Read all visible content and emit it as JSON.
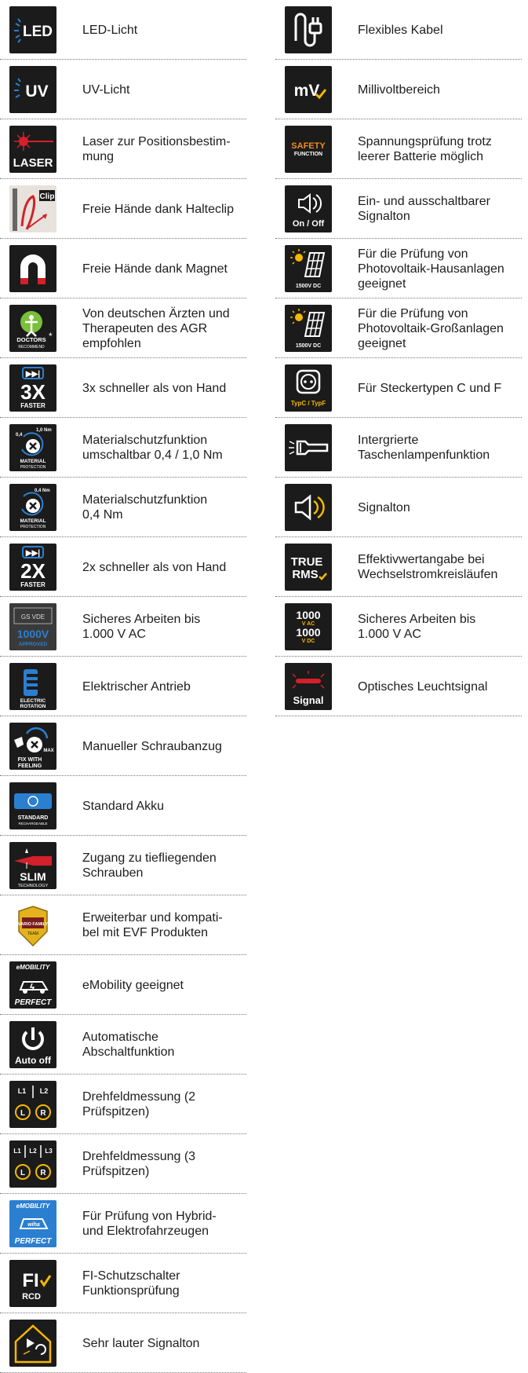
{
  "left_column": [
    {
      "icon": "led-icon",
      "icon_text": "LED",
      "label": "LED-Licht"
    },
    {
      "icon": "uv-icon",
      "icon_text": "UV",
      "label": "UV-Licht"
    },
    {
      "icon": "laser-icon",
      "icon_text": "LASER",
      "label": "Laser zur Positionsbestim-\nmung"
    },
    {
      "icon": "clip-icon",
      "icon_text": "Clip",
      "label": "Freie Hände dank Halteclip"
    },
    {
      "icon": "magnet-icon",
      "icon_text": "",
      "label": "Freie Hände dank Magnet"
    },
    {
      "icon": "doctors-recommend-icon",
      "icon_text": "DOCTORS RECOMMEND",
      "label": "Von deutschen Ärzten und\nTherapeuten des AGR\nempfohlen"
    },
    {
      "icon": "3x-faster-icon",
      "icon_text": "3X FASTER",
      "label": "3x schneller als von Hand"
    },
    {
      "icon": "material-protection-dual-icon",
      "icon_text": "0,4 1,0 Nm MATERIAL PROTECTION",
      "label": "Materialschutzfunktion\numschaltbar 0,4 / 1,0 Nm"
    },
    {
      "icon": "material-protection-icon",
      "icon_text": "0,4 Nm MATERIAL PROTECTION",
      "label": "Materialschutzfunktion\n0,4 Nm"
    },
    {
      "icon": "2x-faster-icon",
      "icon_text": "2X FASTER",
      "label": "2x schneller als von Hand"
    },
    {
      "icon": "1000v-approved-icon",
      "icon_text": "1000V APPROVED",
      "label": "Sicheres Arbeiten bis\n1.000 V AC"
    },
    {
      "icon": "electric-rotation-icon",
      "icon_text": "ELECTRIC ROTATION",
      "label": "Elektrischer Antrieb"
    },
    {
      "icon": "fix-with-feeling-icon",
      "icon_text": "FIX WITH FEELING",
      "label": "Manueller Schraubanzug"
    },
    {
      "icon": "standard-battery-icon",
      "icon_text": "STANDARD RECHARGEABLE",
      "label": "Standard Akku"
    },
    {
      "icon": "slim-technology-icon",
      "icon_text": "SLIM TECHNOLOGY",
      "label": "Zugang zu tiefliegenden\nSchrauben"
    },
    {
      "icon": "vario-family-icon",
      "icon_text": "VARIO FAMILY",
      "label": "Erweiterbar und kompati-\nbel mit EVF Produkten"
    },
    {
      "icon": "emobility-perfect-icon",
      "icon_text": "eMOBILITY PERFECT",
      "label": "eMobility geeignet"
    },
    {
      "icon": "auto-off-icon",
      "icon_text": "Auto off",
      "label": "Automatische\nAbschaltfunktion"
    },
    {
      "icon": "rotary-field-2-icon",
      "icon_text": "L1 L2 L R",
      "label": "Drehfeldmessung (2\nPrüfspitzen)"
    },
    {
      "icon": "rotary-field-3-icon",
      "icon_text": "L1 L2 L3 L R",
      "label": "Drehfeldmessung (3\nPrüfspitzen)"
    },
    {
      "icon": "emobility-wiha-icon",
      "icon_text": "eMOBILITY wiha PERFECT",
      "label": "Für Prüfung von Hybrid-\nund Elektrofahrzeugen"
    },
    {
      "icon": "fi-rcd-icon",
      "icon_text": "FI RCD",
      "label": "FI-Schutzschalter\nFunktionsprüfung"
    },
    {
      "icon": "loud-signal-icon",
      "icon_text": "",
      "label": "Sehr lauter Signalton"
    }
  ],
  "right_column": [
    {
      "icon": "flexible-cable-icon",
      "icon_text": "",
      "label": "Flexibles Kabel"
    },
    {
      "icon": "millivolt-icon",
      "icon_text": "mV",
      "label": "Millivoltbereich"
    },
    {
      "icon": "safety-function-icon",
      "icon_text": "SAFETY FUNCTION",
      "label": "Spannungsprüfung trotz\nleerer Batterie möglich"
    },
    {
      "icon": "signal-on-off-icon",
      "icon_text": "On / Off",
      "label": "Ein- und ausschaltbarer\nSignalton"
    },
    {
      "icon": "photovoltaic-1500v-house-icon",
      "icon_text": "1500V DC",
      "label": "Für die Prüfung von\nPhotovoltaik-Hausanlagen\ngeeignet"
    },
    {
      "icon": "photovoltaic-1500v-large-icon",
      "icon_text": "1500V DC",
      "label": "Für die Prüfung von\nPhotovoltaik-Großanlagen\ngeeignet"
    },
    {
      "icon": "plug-type-cf-icon",
      "icon_text": "TypC / TypF",
      "label": "Für Steckertypen C und F"
    },
    {
      "icon": "flashlight-icon",
      "icon_text": "",
      "label": "Intergrierte\nTaschenlampenfunktion"
    },
    {
      "icon": "signal-tone-icon",
      "icon_text": "",
      "label": "Signalton"
    },
    {
      "icon": "true-rms-icon",
      "icon_text": "TRUE RMS",
      "label": "Effektivwertangabe bei\nWechselstromkreisläufen"
    },
    {
      "icon": "1000v-ac-dc-icon",
      "icon_text": "1000 V AC 1000 V DC",
      "label": "Sicheres Arbeiten bis\n1.000 V AC"
    },
    {
      "icon": "optical-signal-icon",
      "icon_text": "Signal",
      "label": "Optisches Leuchtsignal"
    }
  ],
  "colors": {
    "icon_bg": "#1b1b1b",
    "accent_yellow": "#f5b800",
    "accent_blue": "#2b7fd0",
    "accent_red": "#d3202a",
    "divider": "#777777"
  }
}
